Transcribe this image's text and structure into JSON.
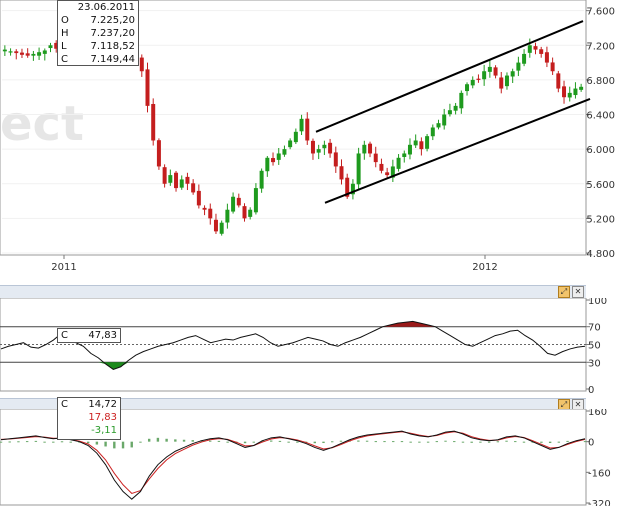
{
  "chart_data": [
    {
      "panel": "price",
      "type": "candlestick",
      "ylim": [
        4800,
        7700
      ],
      "y_ticks": [
        "4.800",
        "5.200",
        "5.600",
        "6.000",
        "6.400",
        "6.800",
        "7.200",
        "7.600"
      ],
      "x_labels": [
        "2011",
        "2012"
      ],
      "tooltip": {
        "date": "23.06.2011",
        "open": "7.225,20",
        "high": "7.237,20",
        "low": "7.118,52",
        "close": "7.149,44"
      },
      "approx_close_path": [
        7150,
        7130,
        7110,
        7090,
        7080,
        7100,
        7120,
        7140,
        7200,
        7160,
        7120,
        7160,
        7200,
        7180,
        7150,
        7190,
        7220,
        7240,
        7210,
        7180,
        7150,
        7120,
        7100,
        7080,
        6900,
        6500,
        6100,
        5800,
        5600,
        5700,
        5550,
        5650,
        5600,
        5500,
        5350,
        5300,
        5200,
        5050,
        5150,
        5300,
        5450,
        5350,
        5200,
        5300,
        5550,
        5750,
        5900,
        5850,
        5950,
        6000,
        6100,
        6200,
        6350,
        6100,
        5950,
        6000,
        6050,
        5950,
        5800,
        5650,
        5450,
        5600,
        5950,
        6050,
        5950,
        5850,
        5750,
        5700,
        5800,
        5900,
        5950,
        6050,
        6100,
        6000,
        6150,
        6250,
        6300,
        6400,
        6450,
        6500,
        6650,
        6750,
        6800,
        6800,
        6900,
        6950,
        6850,
        6700,
        6850,
        6900,
        7000,
        7100,
        7200,
        7150,
        7100,
        7000,
        6900,
        6700,
        6600,
        6650,
        6700,
        6720
      ],
      "trend_channel": {
        "upper": [
          [
            "mid-2011",
            6200
          ],
          [
            "end-2012",
            7480
          ]
        ],
        "lower": [
          [
            "mid-2011",
            5380
          ],
          [
            "end-2012",
            6580
          ]
        ]
      }
    },
    {
      "panel": "rsi",
      "type": "line",
      "ylim": [
        0,
        100
      ],
      "y_ticks": [
        "100",
        "70",
        "50",
        "30",
        "0"
      ],
      "levels": [
        70,
        50,
        30
      ],
      "tooltip": {
        "label": "C",
        "value": "47,83"
      },
      "approx_values": [
        45,
        48,
        50,
        52,
        47,
        46,
        50,
        55,
        62,
        58,
        52,
        48,
        40,
        35,
        28,
        22,
        25,
        32,
        38,
        42,
        45,
        48,
        50,
        52,
        55,
        58,
        60,
        56,
        52,
        54,
        56,
        55,
        58,
        60,
        62,
        58,
        52,
        48,
        50,
        52,
        55,
        58,
        56,
        54,
        50,
        48,
        52,
        55,
        58,
        62,
        66,
        70,
        72,
        74,
        75,
        76,
        74,
        72,
        70,
        65,
        60,
        55,
        50,
        48,
        52,
        56,
        60,
        62,
        65,
        66,
        60,
        55,
        48,
        40,
        38,
        42,
        45,
        47,
        48
      ]
    },
    {
      "panel": "macd",
      "type": "line",
      "ylim": [
        -320,
        160
      ],
      "y_ticks": [
        "160",
        "0",
        "-160",
        "-320"
      ],
      "tooltip": {
        "label": "C",
        "macd": "14,72",
        "signal": "17,83",
        "hist": "-3,11"
      },
      "approx_macd": [
        10,
        15,
        20,
        25,
        30,
        22,
        15,
        20,
        10,
        0,
        -20,
        -60,
        -120,
        -200,
        -260,
        -300,
        -260,
        -180,
        -120,
        -80,
        -50,
        -30,
        -10,
        5,
        15,
        20,
        10,
        -10,
        -30,
        -20,
        5,
        20,
        25,
        15,
        5,
        -10,
        -30,
        -45,
        -30,
        -10,
        10,
        25,
        35,
        40,
        45,
        50,
        55,
        40,
        30,
        25,
        35,
        50,
        55,
        40,
        20,
        10,
        5,
        10,
        25,
        30,
        20,
        0,
        -20,
        -40,
        -30,
        -10,
        5,
        15
      ],
      "approx_signal": [
        12,
        14,
        18,
        22,
        26,
        24,
        18,
        18,
        12,
        3,
        -12,
        -45,
        -95,
        -165,
        -225,
        -270,
        -255,
        -195,
        -140,
        -95,
        -62,
        -40,
        -18,
        -2,
        10,
        16,
        12,
        -3,
        -22,
        -20,
        -2,
        14,
        21,
        17,
        9,
        -4,
        -22,
        -38,
        -32,
        -15,
        4,
        19,
        30,
        37,
        42,
        47,
        52,
        44,
        34,
        27,
        32,
        45,
        52,
        44,
        26,
        14,
        7,
        8,
        20,
        27,
        22,
        5,
        -14,
        -33,
        -30,
        -14,
        1,
        12
      ]
    }
  ],
  "controls": {
    "restore": "⤢",
    "close": "✕"
  }
}
